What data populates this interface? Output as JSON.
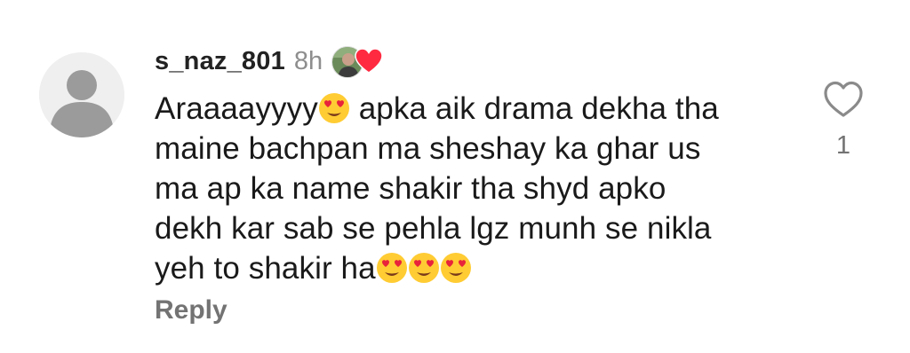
{
  "comment": {
    "username": "s_naz_801",
    "time": "8h",
    "text_segments": [
      "Araaaayyyy",
      " apka aik drama dekha tha\nmaine bachpan ma sheshay ka ghar us\nma ap ka name shakir tha shyd apko\ndekh kar sab se pehla lgz munh se nikla\nyeh to shakir ha"
    ],
    "reply_label": "Reply",
    "like_count": "1",
    "icons": {
      "avatar": "default-user-icon",
      "liked_by_avatar": "profile-photo",
      "liked_by_heart": "red-heart-icon",
      "emoji": "heart-eyes-emoji",
      "like": "heart-outline-icon"
    },
    "colors": {
      "heart": "#ff2a40",
      "muted": "#737373",
      "emoji_face": "#ffcc33"
    }
  }
}
